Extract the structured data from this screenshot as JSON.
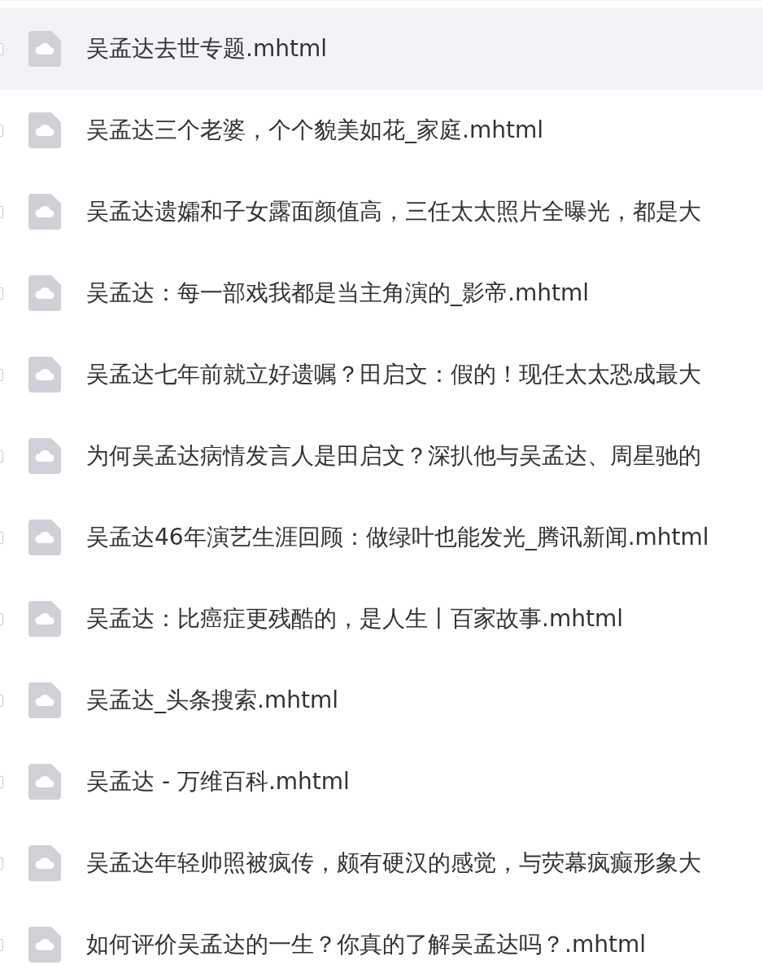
{
  "files": [
    {
      "name": "吴孟达去世专题.mhtml",
      "selected": true
    },
    {
      "name": "吴孟达三个老婆，个个貌美如花_家庭.mhtml",
      "selected": false
    },
    {
      "name": "吴孟达遗孀和子女露面颜值高，三任太太照片全曝光，都是大",
      "selected": false
    },
    {
      "name": "吴孟达：每一部戏我都是当主角演的_影帝.mhtml",
      "selected": false
    },
    {
      "name": "吴孟达七年前就立好遗嘱？田启文：假的！现任太太恐成最大",
      "selected": false
    },
    {
      "name": "为何吴孟达病情发言人是田启文？深扒他与吴孟达、周星驰的",
      "selected": false
    },
    {
      "name": "吴孟达46年演艺生涯回顾：做绿叶也能发光_腾讯新闻.mhtml",
      "selected": false
    },
    {
      "name": "吴孟达：比癌症更残酷的，是人生丨百家故事.mhtml",
      "selected": false
    },
    {
      "name": "吴孟达_头条搜索.mhtml",
      "selected": false
    },
    {
      "name": "吴孟达 - 万维百科.mhtml",
      "selected": false
    },
    {
      "name": "吴孟达年轻帅照被疯传，颇有硬汉的感觉，与荧幕疯癫形象大",
      "selected": false
    },
    {
      "name": "如何评价吴孟达的一生？你真的了解吴孟达吗？.mhtml",
      "selected": false
    }
  ]
}
